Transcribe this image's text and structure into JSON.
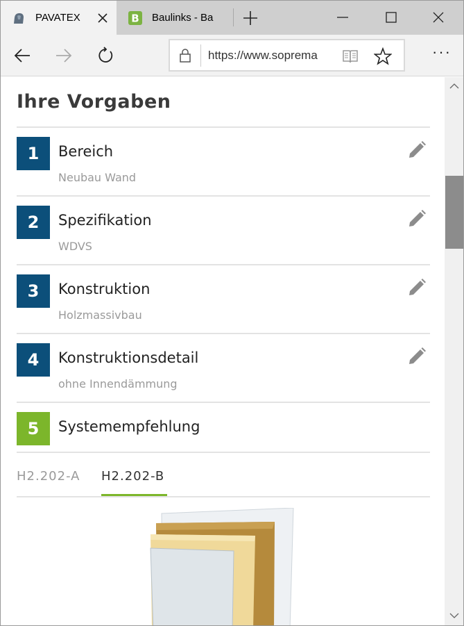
{
  "browser": {
    "tabs": [
      {
        "title": "PAVATEX",
        "active": true,
        "favicon": "pavatex-logo-icon"
      },
      {
        "title": "Baulinks - Ba",
        "active": false,
        "favicon": "baulinks-logo-icon"
      }
    ],
    "address": {
      "url": "https://www.sopremа",
      "lock_icon": "lock-icon",
      "reader_icon": "reading-view-icon",
      "favorite_icon": "star-icon"
    },
    "more_label": "···"
  },
  "page": {
    "title": "Ihre Vorgaben",
    "steps": [
      {
        "number": "1",
        "label": "Bereich",
        "value": "Neubau Wand",
        "status": "done"
      },
      {
        "number": "2",
        "label": "Spezifikation",
        "value": "WDVS",
        "status": "done"
      },
      {
        "number": "3",
        "label": "Konstruktion",
        "value": "Holzmassivbau",
        "status": "done"
      },
      {
        "number": "4",
        "label": "Konstruktionsdetail",
        "value": "ohne Innendämmung",
        "status": "done"
      },
      {
        "number": "5",
        "label": "Systemempfehlung",
        "value": "",
        "status": "current"
      }
    ],
    "product_tabs": [
      {
        "label": "H2.202-A",
        "active": false
      },
      {
        "label": "H2.202-B",
        "active": true
      }
    ]
  },
  "colors": {
    "step_done": "#0c4f7a",
    "step_current": "#7cb62b",
    "tab_underline": "#7cb62b"
  }
}
